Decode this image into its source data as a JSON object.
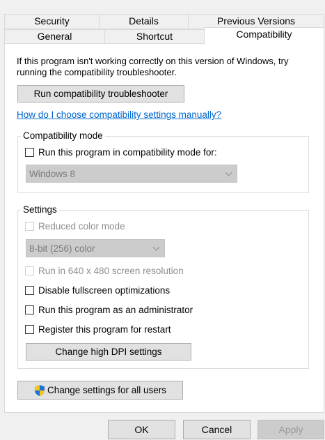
{
  "tabs": {
    "row1": [
      "Security",
      "Details",
      "Previous Versions"
    ],
    "row2": [
      "General",
      "Shortcut",
      "Compatibility"
    ],
    "active": "Compatibility"
  },
  "intro_text": "If this program isn't working correctly on this version of Windows, try running the compatibility troubleshooter.",
  "run_troubleshooter_label": "Run compatibility troubleshooter",
  "manual_link": "How do I choose compatibility settings manually?",
  "compat_mode": {
    "title": "Compatibility mode",
    "checkbox_label": "Run this program in compatibility mode for:",
    "checked": false,
    "selected_os": "Windows 8"
  },
  "settings": {
    "title": "Settings",
    "reduced_color_label": "Reduced color mode",
    "color_depth": "8-bit (256) color",
    "resolution_label": "Run in 640 x 480 screen resolution",
    "disable_fullscreen_label": "Disable fullscreen optimizations",
    "run_as_admin_label": "Run this program as an administrator",
    "register_restart_label": "Register this program for restart",
    "dpi_button_label": "Change high DPI settings"
  },
  "all_users_button_label": "Change settings for all users",
  "buttons": {
    "ok": "OK",
    "cancel": "Cancel",
    "apply": "Apply"
  },
  "colors": {
    "link": "#0066cc",
    "shield_blue": "#1e6fd9",
    "shield_yellow": "#f5c518"
  },
  "icons": {
    "uac": "uac-shield-icon"
  }
}
